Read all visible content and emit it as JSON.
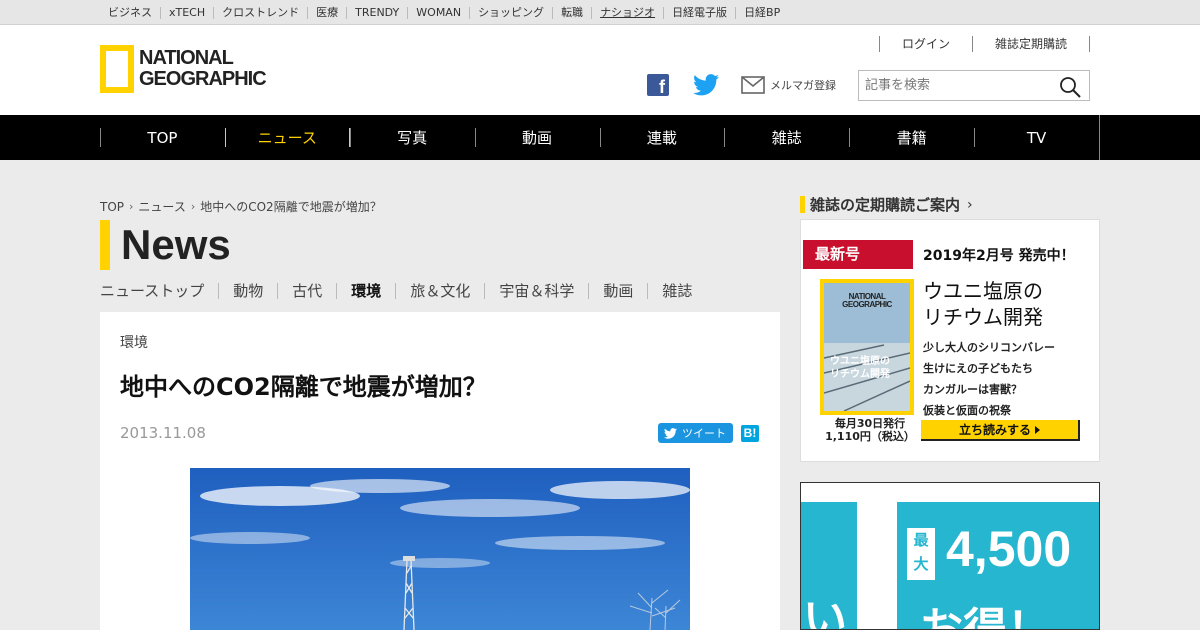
{
  "network_bar": {
    "items": [
      "ビジネス",
      "xTECH",
      "クロストレンド",
      "医療",
      "TRENDY",
      "WOMAN",
      "ショッピング",
      "転職",
      "ナショジオ",
      "日経電子版",
      "日経BP"
    ],
    "current": "ナショジオ"
  },
  "header": {
    "logo_line1": "NATIONAL",
    "logo_line2": "GEOGRAPHIC",
    "login": "ログイン",
    "subscription": "雑誌定期購読",
    "newsletter": "メルマガ登録",
    "search_placeholder": "記事を検索"
  },
  "global_nav": {
    "items": [
      "TOP",
      "ニュース",
      "写真",
      "動画",
      "連載",
      "雑誌",
      "書籍",
      "TV"
    ],
    "active": "ニュース"
  },
  "breadcrumb": [
    "TOP",
    "ニュース",
    "地中へのCO2隔離で地震が増加？"
  ],
  "section_title": "News",
  "category_tabs": {
    "items": [
      "ニューストップ",
      "動物",
      "古代",
      "環境",
      "旅＆文化",
      "宇宙＆科学",
      "動画",
      "雑誌"
    ],
    "active": "環境"
  },
  "article": {
    "category": "環境",
    "title": "地中へのCO2隔離で地震が増加？",
    "date": "2013.11.08",
    "tweet_label": "ツイート",
    "hatena_label": "B!"
  },
  "sidebar": {
    "heading": "雑誌の定期購読ご案内",
    "badge": "最新号",
    "issue": "2019年2月号 発売中！",
    "cover_logo_1": "NATIONAL",
    "cover_logo_2": "GEOGRAPHIC",
    "cover_title_1": "ウユニ塩原の",
    "cover_title_2": "リチウム開発",
    "cover_caption_1": "毎月30日発行",
    "cover_caption_2": "1,110円（税込）",
    "feature_1": "ウユニ塩原の",
    "feature_2": "リチウム開発",
    "articles": [
      "少し大人のシリコンバレー",
      "生けにえの子どもたち",
      "カンガルーは害獣？",
      "仮装と仮面の祝祭"
    ],
    "read_button": "立ち読みする"
  },
  "ad": {
    "tag_1": "最",
    "tag_2": "大",
    "amount": "4,500",
    "otoku": "お得！",
    "hira": "い"
  },
  "colors": {
    "brand_yellow": "#ffd200",
    "nav_black": "#000000",
    "badge_red": "#c8102e",
    "twitter_blue": "#1b95e0",
    "facebook_blue": "#3b5998",
    "ad_cyan": "#27b6cf"
  }
}
